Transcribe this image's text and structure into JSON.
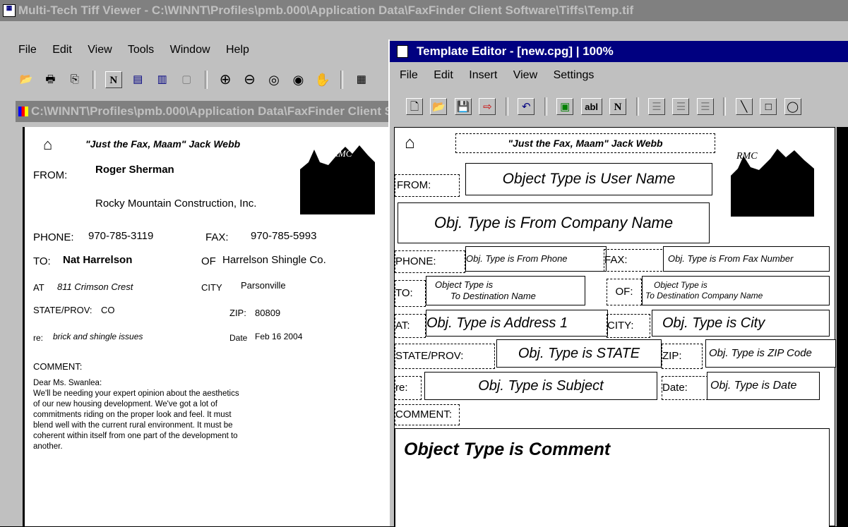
{
  "viewer": {
    "title": "Multi-Tech Tiff Viewer - C:\\WINNT\\Profiles\\pmb.000\\Application Data\\FaxFinder Client Software\\Tiffs\\Temp.tif",
    "menu": [
      "File",
      "Edit",
      "View",
      "Tools",
      "Window",
      "Help"
    ],
    "doc_title": "C:\\WINNT\\Profiles\\pmb.000\\Application Data\\FaxFinder Client Software"
  },
  "fax": {
    "quote": "\"Just the Fax, Maam\"  Jack Webb",
    "logo_text": "RMC",
    "from_label": "FROM:",
    "from_name": "Roger Sherman",
    "from_company": "Rocky Mountain Construction, Inc.",
    "phone_label": "PHONE:",
    "phone": "970-785-3119",
    "fax_label": "FAX:",
    "fax": "970-785-5993",
    "to_label": "TO:",
    "to_name": "Nat Harrelson",
    "of_label": "OF",
    "of_company": "Harrelson Shingle Co.",
    "at_label": "AT",
    "address": "811 Crimson Crest",
    "city_label": "CITY",
    "city": "Parsonville",
    "state_label": "STATE/PROV:",
    "state": "CO",
    "zip_label": "ZIP:",
    "zip": "80809",
    "re_label": "re:",
    "subject": "brick and shingle issues",
    "date_label": "Date",
    "date": "Feb 16 2004",
    "comment_label": "COMMENT:",
    "comment_lines": [
      "Dear Ms. Swanlea:",
      " We'll be needing your expert opinion about the aesthetics",
      "of our new housing development.  We've got a lot of",
      "commitments riding on the proper look and feel.  It must",
      "blend well with the current rural environment.  It must be",
      "coherent within itself from one part of the development to",
      "another."
    ]
  },
  "editor": {
    "title": "Template Editor - [new.cpg] | 100%",
    "menu": [
      "File",
      "Edit",
      "Insert",
      "View",
      "Settings"
    ],
    "toolbar_text_button": "abl",
    "toolbar_n_button": "N",
    "quote": "\"Just the Fax, Maam\"  Jack Webb",
    "logo_text": "RMC",
    "from_label": "FROM:",
    "user_name_field": "Object Type is User Name",
    "company_field": "Obj. Type is From Company Name",
    "phone_label": "PHONE:",
    "phone_field": "Obj. Type is From Phone",
    "fax_label": "FAX:",
    "fax_field": "Obj. Type is From Fax Number",
    "to_label": "TO:",
    "dest_name_line1": "Object Type is",
    "dest_name_line2": "To Destination Name",
    "of_label": "OF:",
    "dest_company_line1": "Object Type is",
    "dest_company_line2": "To Destination Company Name",
    "at_label": "AT:",
    "address_field": "Obj. Type is Address 1",
    "city_label": "CITY:",
    "city_field": "Obj. Type is City",
    "state_label": "STATE/PROV:",
    "state_field": "Obj. Type is STATE",
    "zip_label": "ZIP:",
    "zip_field": "Obj. Type is ZIP Code",
    "re_label": "re:",
    "subject_field": "Obj. Type is Subject",
    "date_label": "Date:",
    "date_field": "Obj. Type is Date",
    "comment_label": "COMMENT:",
    "comment_field": "Object Type is Comment"
  }
}
